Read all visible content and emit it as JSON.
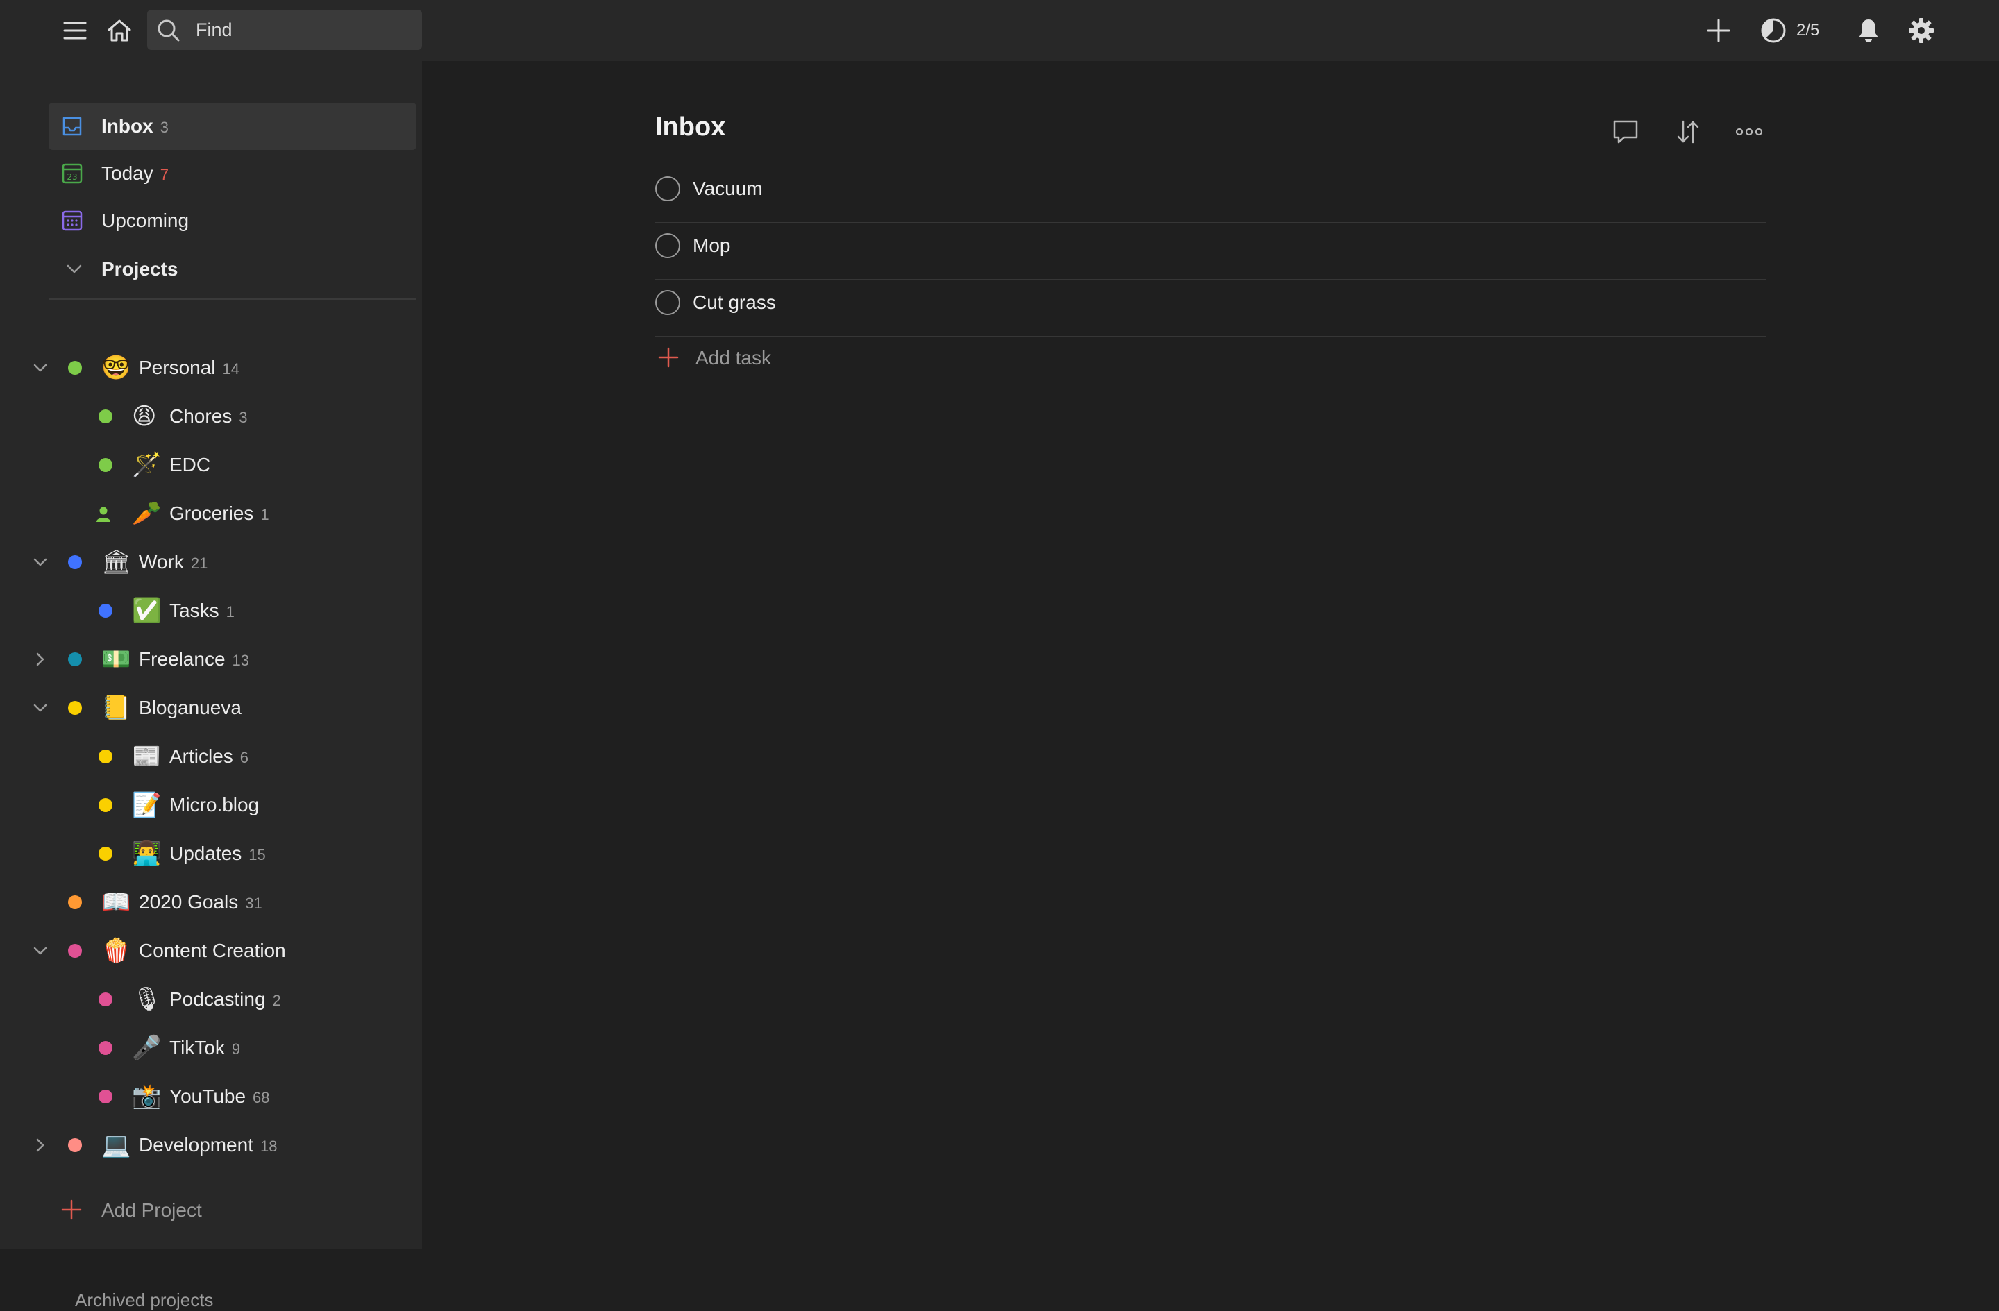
{
  "topbar": {
    "search_placeholder": "Find",
    "karma_value": "2/5"
  },
  "nav": [
    {
      "label": "Inbox",
      "count": "3",
      "icon": "inbox-icon",
      "active": true
    },
    {
      "label": "Today",
      "count": "7",
      "icon": "calendar-today-icon",
      "active": false
    },
    {
      "label": "Upcoming",
      "count": "",
      "icon": "calendar-grid-icon",
      "active": false
    }
  ],
  "projects_header": "Projects",
  "projects": [
    {
      "label": "Personal",
      "count": "14",
      "emoji": "🤓",
      "color": "#7ecc49",
      "level": 0,
      "chevron": "down"
    },
    {
      "label": "Chores",
      "count": "3",
      "emoji": "😩",
      "color": "#7ecc49",
      "level": 1,
      "chevron": ""
    },
    {
      "label": "EDC",
      "count": "",
      "emoji": "🪄",
      "color": "#7ecc49",
      "level": 1,
      "chevron": ""
    },
    {
      "label": "Groceries",
      "count": "1",
      "emoji": "🥕",
      "color": "#7ecc49",
      "level": 1,
      "chevron": "",
      "shared": true
    },
    {
      "label": "Work",
      "count": "21",
      "emoji": "🏛",
      "color": "#4073ff",
      "level": 0,
      "chevron": "down"
    },
    {
      "label": "Tasks",
      "count": "1",
      "emoji": "✅",
      "color": "#4073ff",
      "level": 1,
      "chevron": ""
    },
    {
      "label": "Freelance",
      "count": "13",
      "emoji": "💵",
      "color": "#158fad",
      "level": 0,
      "chevron": "right"
    },
    {
      "label": "Bloganueva",
      "count": "",
      "emoji": "📒",
      "color": "#fad000",
      "level": 0,
      "chevron": "down"
    },
    {
      "label": "Articles",
      "count": "6",
      "emoji": "📰",
      "color": "#fad000",
      "level": 1,
      "chevron": ""
    },
    {
      "label": "Micro.blog",
      "count": "",
      "emoji": "📝",
      "color": "#fad000",
      "level": 1,
      "chevron": ""
    },
    {
      "label": "Updates",
      "count": "15",
      "emoji": "👨‍💻",
      "color": "#fad000",
      "level": 1,
      "chevron": ""
    },
    {
      "label": "2020 Goals",
      "count": "31",
      "emoji": "📖",
      "color": "#ff9933",
      "level": 0,
      "chevron": ""
    },
    {
      "label": "Content Creation",
      "count": "",
      "emoji": "🍿",
      "color": "#e05194",
      "level": 0,
      "chevron": "down"
    },
    {
      "label": "Podcasting",
      "count": "2",
      "emoji": "🎙",
      "color": "#e05194",
      "level": 1,
      "chevron": ""
    },
    {
      "label": "TikTok",
      "count": "9",
      "emoji": "🎤",
      "color": "#e05194",
      "level": 1,
      "chevron": ""
    },
    {
      "label": "YouTube",
      "count": "68",
      "emoji": "📸",
      "color": "#e05194",
      "level": 1,
      "chevron": ""
    },
    {
      "label": "Development",
      "count": "18",
      "emoji": "💻",
      "color": "#ff8d85",
      "level": 0,
      "chevron": "right"
    }
  ],
  "add_project_label": "Add Project",
  "archived_label": "Archived projects",
  "main": {
    "title": "Inbox",
    "tasks": [
      {
        "label": "Vacuum"
      },
      {
        "label": "Mop"
      },
      {
        "label": "Cut grass"
      }
    ],
    "add_task_label": "Add task"
  },
  "colors": {
    "accent_red": "#e05a4f",
    "inbox_blue": "#4a90e2",
    "today_green": "#4aa84a",
    "upcoming_purple": "#8a6ae8"
  }
}
